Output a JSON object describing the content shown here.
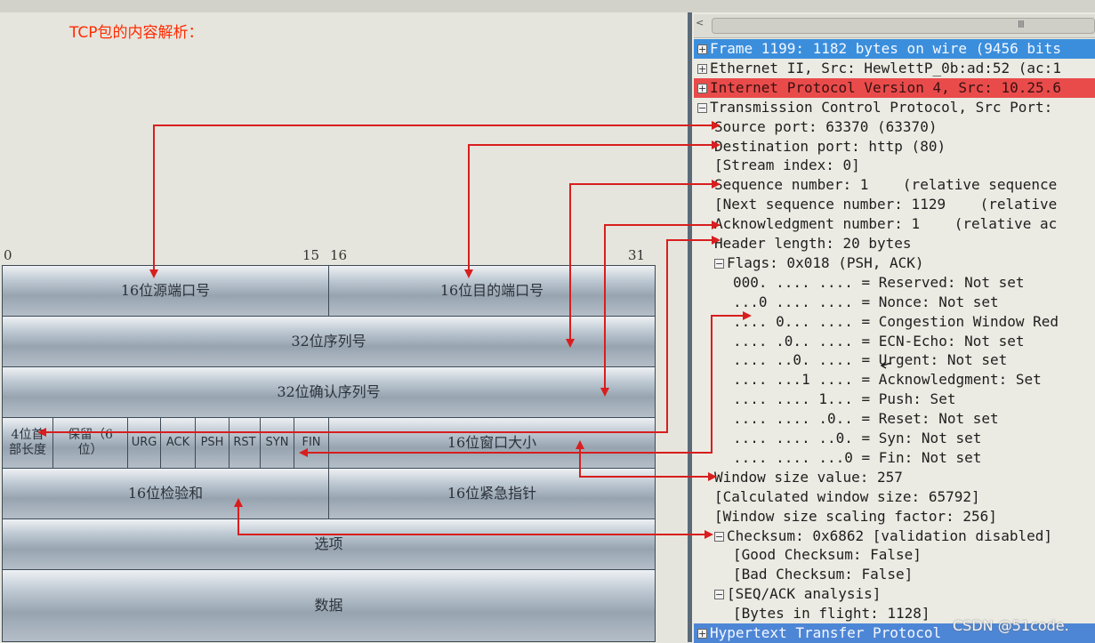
{
  "heading": "TCP包的内容解析：",
  "bit_scale": {
    "b0": "0",
    "b15": "15",
    "b16": "16",
    "b31": "31"
  },
  "header_fields": {
    "src_port": "16位源端口号",
    "dst_port": "16位目的端口号",
    "seq": "32位序列号",
    "ack": "32位确认序列号",
    "hdr_len_line1": "4位首",
    "hdr_len_line2": "部长度",
    "reserved_line1": "保留（6",
    "reserved_line2": "位）",
    "urg": "URG",
    "ackflag": "ACK",
    "psh": "PSH",
    "rst": "RST",
    "syn": "SYN",
    "fin": "FIN",
    "window": "16位窗口大小",
    "checksum": "16位检验和",
    "urgent": "16位紧急指针",
    "options": "选项",
    "data": "数据"
  },
  "scrollbar": {
    "left_arrow": "<",
    "grip": "III"
  },
  "tree": [
    {
      "text": "Frame 1199: 1182 bytes on wire (9456 bits",
      "toggle": "+",
      "indent": 0,
      "style": "hl-blue"
    },
    {
      "text": "Ethernet II, Src: HewlettP_0b:ad:52 (ac:1",
      "toggle": "+",
      "indent": 0,
      "style": ""
    },
    {
      "text": "Internet Protocol Version 4, Src: 10.25.6",
      "toggle": "+",
      "indent": 0,
      "style": "hl-red"
    },
    {
      "text": "Transmission Control Protocol, Src Port:",
      "toggle": "−",
      "indent": 0,
      "style": ""
    },
    {
      "text": "Source port: 63370 (63370)",
      "toggle": "",
      "indent": 1,
      "style": ""
    },
    {
      "text": "Destination port: http (80)",
      "toggle": "",
      "indent": 1,
      "style": ""
    },
    {
      "text": "[Stream index: 0]",
      "toggle": "",
      "indent": 1,
      "style": ""
    },
    {
      "text": "Sequence number: 1    (relative sequence",
      "toggle": "",
      "indent": 1,
      "style": ""
    },
    {
      "text": "[Next sequence number: 1129    (relative",
      "toggle": "",
      "indent": 1,
      "style": ""
    },
    {
      "text": "Acknowledgment number: 1    (relative ac",
      "toggle": "",
      "indent": 1,
      "style": ""
    },
    {
      "text": "Header length: 20 bytes",
      "toggle": "",
      "indent": 1,
      "style": ""
    },
    {
      "text": "Flags: 0x018 (PSH, ACK)",
      "toggle": "−",
      "indent": 1,
      "style": ""
    },
    {
      "text": "000. .... .... = Reserved: Not set",
      "toggle": "",
      "indent": 2,
      "style": ""
    },
    {
      "text": "...0 .... .... = Nonce: Not set",
      "toggle": "",
      "indent": 2,
      "style": ""
    },
    {
      "text": ".... 0... .... = Congestion Window Red",
      "toggle": "",
      "indent": 2,
      "style": ""
    },
    {
      "text": ".... .0.. .... = ECN-Echo: Not set",
      "toggle": "",
      "indent": 2,
      "style": ""
    },
    {
      "text": ".... ..0. .... = Urgent: Not set",
      "toggle": "",
      "indent": 2,
      "style": ""
    },
    {
      "text": ".... ...1 .... = Acknowledgment: Set",
      "toggle": "",
      "indent": 2,
      "style": ""
    },
    {
      "text": ".... .... 1... = Push: Set",
      "toggle": "",
      "indent": 2,
      "style": ""
    },
    {
      "text": ".... .... .0.. = Reset: Not set",
      "toggle": "",
      "indent": 2,
      "style": ""
    },
    {
      "text": ".... .... ..0. = Syn: Not set",
      "toggle": "",
      "indent": 2,
      "style": ""
    },
    {
      "text": ".... .... ...0 = Fin: Not set",
      "toggle": "",
      "indent": 2,
      "style": ""
    },
    {
      "text": "Window size value: 257",
      "toggle": "",
      "indent": 1,
      "style": ""
    },
    {
      "text": "[Calculated window size: 65792]",
      "toggle": "",
      "indent": 1,
      "style": ""
    },
    {
      "text": "[Window size scaling factor: 256]",
      "toggle": "",
      "indent": 1,
      "style": ""
    },
    {
      "text": "Checksum: 0x6862 [validation disabled]",
      "toggle": "−",
      "indent": 1,
      "style": ""
    },
    {
      "text": "[Good Checksum: False]",
      "toggle": "",
      "indent": 2,
      "style": ""
    },
    {
      "text": "[Bad Checksum: False]",
      "toggle": "",
      "indent": 2,
      "style": ""
    },
    {
      "text": "[SEQ/ACK analysis]",
      "toggle": "−",
      "indent": 1,
      "style": ""
    },
    {
      "text": "[Bytes in flight: 1128]",
      "toggle": "",
      "indent": 2,
      "style": ""
    },
    {
      "text": "Hypertext Transfer Protocol",
      "toggle": "+",
      "indent": 0,
      "style": "hl-blue2"
    }
  ],
  "watermark": "CSDN @51code.",
  "colors": {
    "arrow": "#d81e1e",
    "heading": "#ff2a00"
  }
}
